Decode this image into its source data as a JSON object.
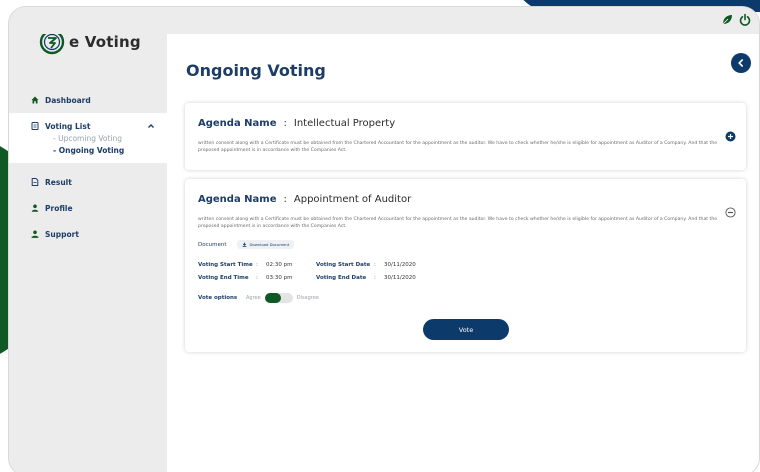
{
  "app": {
    "name": "e Voting"
  },
  "sidebar": {
    "dashboard": "Dashboard",
    "voting_list": "Voting List",
    "upcoming": "- Upcoming Voting",
    "ongoing": "- Ongoing Voting",
    "result": "Result",
    "profile": "Profile",
    "support": "Support"
  },
  "main": {
    "title": "Ongoing Voting"
  },
  "cards": [
    {
      "agenda_label": "Agenda Name",
      "separator": ":",
      "agenda_value": "Intellectual Property",
      "description": "written consent along with a Certificate must be obtained from the Chartered Accountant for the appointment as the auditor. We have to check whether he/she is eligible for appointment as Auditor of a Company. And that the proposed appointment is in accordance with the Companies Act."
    },
    {
      "agenda_label": "Agenda Name",
      "separator": ":",
      "agenda_value": "Appointment of Auditor",
      "description": "written consent along with a Certificate must be obtained from the Chartered Accountant for the appointment as the auditor. We have to check whether he/she is eligible for appointment as Auditor of a Company. And that the proposed appointment is in accordance with the Companies Act.",
      "document_label": "Document",
      "download_label": "Download Document",
      "start_time_label": "Voting Start Time",
      "start_time": "02:30 pm",
      "start_date_label": "Voting Start Date",
      "start_date": "30/11/2020",
      "end_time_label": "Voting End Time",
      "end_time": "03:30 pm",
      "end_date_label": "Voting End Date",
      "end_date": "30/11/2020",
      "colon": ":",
      "vote_options_label": "Vote options",
      "agree_label": "Agree",
      "disagree_label": "Disagree",
      "selected_option": "Agree",
      "vote_button": "Vote"
    }
  ],
  "colors": {
    "brand_navy": "#0c3a6b",
    "brand_green": "#0f5a24",
    "text_navy": "#1d3d66",
    "sidebar_bg": "#ececec"
  },
  "icons": [
    "leaf-icon",
    "power-icon",
    "logo-icon",
    "home-icon",
    "document-icon",
    "chevron-up-icon",
    "file-icon",
    "user-icon",
    "support-icon",
    "back-arrow-icon",
    "plus-circle-icon",
    "minus-circle-icon",
    "download-icon"
  ]
}
